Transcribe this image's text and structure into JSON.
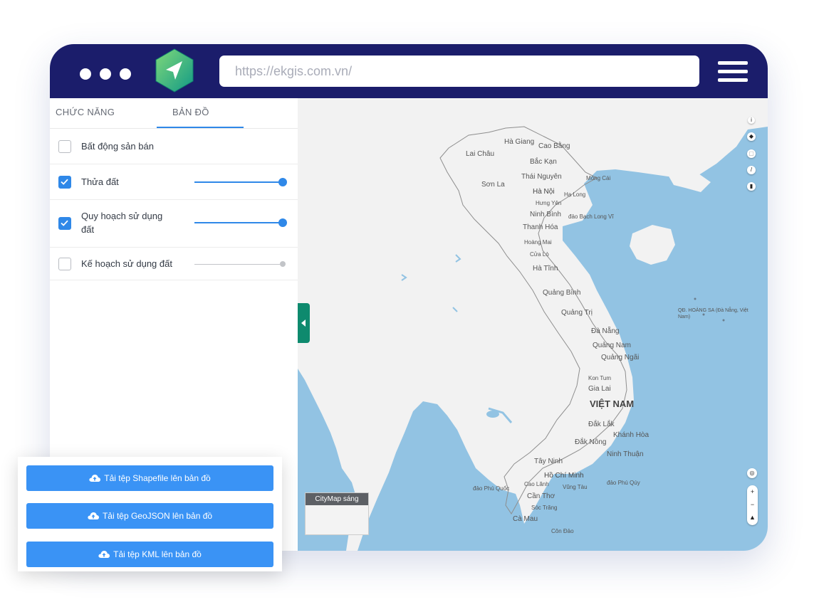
{
  "browser": {
    "url": "https://ekgis.com.vn/",
    "logo_icon": "navigation-arrow-icon",
    "menu_icon": "hamburger-menu-icon"
  },
  "sidebar": {
    "tabs": [
      {
        "label": "CHỨC NĂNG",
        "active": false
      },
      {
        "label": "BẢN ĐỒ",
        "active": true
      }
    ],
    "layers": [
      {
        "label": "Bất động sản bán",
        "checked": false,
        "has_slider": false
      },
      {
        "label": "Thửa đất",
        "checked": true,
        "has_slider": true,
        "opacity": 1.0
      },
      {
        "label": "Quy hoạch sử dụng",
        "label2": "đất",
        "checked": true,
        "has_slider": true,
        "opacity": 1.0
      },
      {
        "label": "Kế hoạch sử dụng đất",
        "checked": false,
        "has_slider": true,
        "opacity": 1.0
      }
    ]
  },
  "map": {
    "country_label": "VIỆT NAM",
    "places": [
      "Hà Giang",
      "Cao Bằng",
      "Lai Châu",
      "Bắc Kạn",
      "Thái Nguyên",
      "Móng Cái",
      "Sơn La",
      "Hà Nội",
      "Hạ Long",
      "Hưng Yên",
      "Ninh Bình",
      "đảo Bạch Long Vĩ",
      "Thanh Hóa",
      "Hoàng Mai",
      "Cửa Lò",
      "Hà Tĩnh",
      "Quảng Bình",
      "Quảng Trị",
      "QĐ. HOÀNG SA (Đà Nẵng, Việt Nam)",
      "Đà Nẵng",
      "Quảng Nam",
      "Quảng Ngãi",
      "Kon Tum",
      "Gia Lai",
      "Đắk Lắk",
      "Khánh Hòa",
      "Đắk Nông",
      "Ninh Thuận",
      "Tây Ninh",
      "Hồ Chí Minh",
      "Cao Lãnh",
      "Vũng Tàu",
      "đảo Phú Qúy",
      "đảo Phú Quốc",
      "Cần Thơ",
      "Sóc Trăng",
      "Cà Mau",
      "Côn Đảo"
    ],
    "minimap_label": "CityMap sáng",
    "controls": [
      "info-icon",
      "layers-icon",
      "select-icon",
      "draw-icon",
      "delete-icon",
      "locate-icon",
      "zoom-in-icon",
      "zoom-out-icon",
      "compass-icon"
    ]
  },
  "upload": {
    "buttons": [
      {
        "label": "Tải tệp Shapefile lên bản đồ",
        "icon": "cloud-upload-icon"
      },
      {
        "label": "Tải tệp GeoJSON lên bản đồ",
        "icon": "cloud-upload-icon"
      },
      {
        "label": "Tải tệp KML lên bản đồ",
        "icon": "cloud-upload-icon"
      }
    ]
  },
  "colors": {
    "titlebar": "#1b1d6b",
    "accent": "#2f88e8",
    "button": "#3a93f5",
    "sea": "#92c3e3",
    "land": "#f2f2f2",
    "logo": "#1fae7d"
  }
}
